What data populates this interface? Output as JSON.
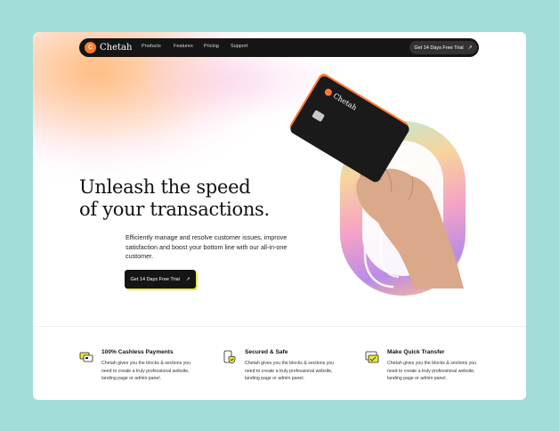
{
  "brand": {
    "name": "Chetah",
    "mark": "C",
    "accent": "#ff7a2e"
  },
  "nav": {
    "links": [
      "Products",
      "Features",
      "Pricing",
      "Support"
    ],
    "cta_label": "Get 14 Days Free Trial",
    "cta_icon": "arrow-up-right-icon"
  },
  "hero": {
    "title_line1": "Unleash the speed",
    "title_line2": "of your transactions.",
    "subtitle": "Efficiently manage and resolve customer issues, improve satisfaction and boost your bottom line with our all-in-one customer.",
    "cta_label": "Get 14 Days Free Trial"
  },
  "card": {
    "brand": "Chetah"
  },
  "features": [
    {
      "icon": "cashless-payment-icon",
      "title": "100% Cashless Payments",
      "desc": "Chetah gives you the blocks & sections you need to create a truly professional website, landing page or admin panel."
    },
    {
      "icon": "secure-shield-icon",
      "title": "Secured & Safe",
      "desc": "Chetah gives you the blocks & sections you need to create a truly professional website, landing page or admin panel."
    },
    {
      "icon": "quick-transfer-icon",
      "title": "Make Quick Transfer",
      "desc": "Chetah gives you the blocks & sections you need to create a truly professional website, landing page or admin panel."
    }
  ],
  "colors": {
    "background": "#a3ddd9",
    "nav_bg": "#151515",
    "cta_shadow": "#e8ea3a",
    "icon_yellow": "#e8ea3a"
  }
}
